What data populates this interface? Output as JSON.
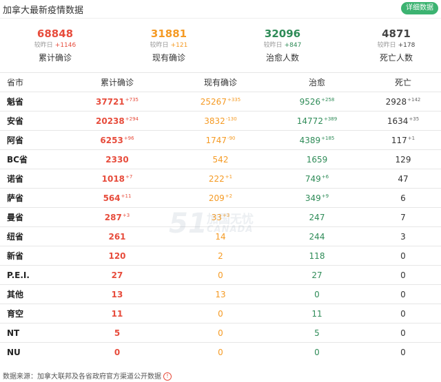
{
  "header": {
    "title": "加拿大最新疫情数据",
    "detail_label": "详细数据"
  },
  "summary": [
    {
      "value": "68848",
      "cmp_label": "较昨日",
      "inc": "+1146",
      "label": "累计确诊",
      "color": "#e74c3c"
    },
    {
      "value": "31881",
      "cmp_label": "较昨日",
      "inc": "+121",
      "label": "现有确诊",
      "color": "#f59a23"
    },
    {
      "value": "32096",
      "cmp_label": "较昨日",
      "inc": "+847",
      "label": "治愈人数",
      "color": "#2e8b57"
    },
    {
      "value": "4871",
      "cmp_label": "较昨日",
      "inc": "+178",
      "label": "死亡人数",
      "color": "#444444"
    }
  ],
  "table": {
    "columns": [
      "省市",
      "累计确诊",
      "现有确诊",
      "治愈",
      "死亡"
    ],
    "rows": [
      {
        "prov": "魁省",
        "total": "37721",
        "total_inc": "+735",
        "active": "25267",
        "active_inc": "+335",
        "cured": "9526",
        "cured_inc": "+258",
        "dead": "2928",
        "dead_inc": "+142"
      },
      {
        "prov": "安省",
        "total": "20238",
        "total_inc": "+294",
        "active": "3832",
        "active_inc": "-130",
        "cured": "14772",
        "cured_inc": "+389",
        "dead": "1634",
        "dead_inc": "+35"
      },
      {
        "prov": "阿省",
        "total": "6253",
        "total_inc": "+96",
        "active": "1747",
        "active_inc": "-90",
        "cured": "4389",
        "cured_inc": "+185",
        "dead": "117",
        "dead_inc": "+1"
      },
      {
        "prov": "BC省",
        "total": "2330",
        "total_inc": "",
        "active": "542",
        "active_inc": "",
        "cured": "1659",
        "cured_inc": "",
        "dead": "129",
        "dead_inc": ""
      },
      {
        "prov": "诺省",
        "total": "1018",
        "total_inc": "+7",
        "active": "222",
        "active_inc": "+1",
        "cured": "749",
        "cured_inc": "+6",
        "dead": "47",
        "dead_inc": ""
      },
      {
        "prov": "萨省",
        "total": "564",
        "total_inc": "+11",
        "active": "209",
        "active_inc": "+2",
        "cured": "349",
        "cured_inc": "+9",
        "dead": "6",
        "dead_inc": ""
      },
      {
        "prov": "曼省",
        "total": "287",
        "total_inc": "+3",
        "active": "33",
        "active_inc": "+3",
        "cured": "247",
        "cured_inc": "",
        "dead": "7",
        "dead_inc": ""
      },
      {
        "prov": "纽省",
        "total": "261",
        "total_inc": "",
        "active": "14",
        "active_inc": "",
        "cured": "244",
        "cured_inc": "",
        "dead": "3",
        "dead_inc": ""
      },
      {
        "prov": "新省",
        "total": "120",
        "total_inc": "",
        "active": "2",
        "active_inc": "",
        "cured": "118",
        "cured_inc": "",
        "dead": "0",
        "dead_inc": ""
      },
      {
        "prov": "P.E.I.",
        "total": "27",
        "total_inc": "",
        "active": "0",
        "active_inc": "",
        "cured": "27",
        "cured_inc": "",
        "dead": "0",
        "dead_inc": ""
      },
      {
        "prov": "其他",
        "total": "13",
        "total_inc": "",
        "active": "13",
        "active_inc": "",
        "cured": "0",
        "cured_inc": "",
        "dead": "0",
        "dead_inc": ""
      },
      {
        "prov": "育空",
        "total": "11",
        "total_inc": "",
        "active": "0",
        "active_inc": "",
        "cured": "11",
        "cured_inc": "",
        "dead": "0",
        "dead_inc": ""
      },
      {
        "prov": "NT",
        "total": "5",
        "total_inc": "",
        "active": "0",
        "active_inc": "",
        "cured": "5",
        "cured_inc": "",
        "dead": "0",
        "dead_inc": ""
      },
      {
        "prov": "NU",
        "total": "0",
        "total_inc": "",
        "active": "0",
        "active_inc": "",
        "cured": "0",
        "cured_inc": "",
        "dead": "0",
        "dead_inc": ""
      }
    ]
  },
  "watermark": {
    "num": "51",
    "cn": "加国无忧",
    "en": "CANADA"
  },
  "footer": {
    "text": "数据来源：加拿大联邦及各省政府官方渠道公开数据",
    "icon": "info-icon"
  }
}
